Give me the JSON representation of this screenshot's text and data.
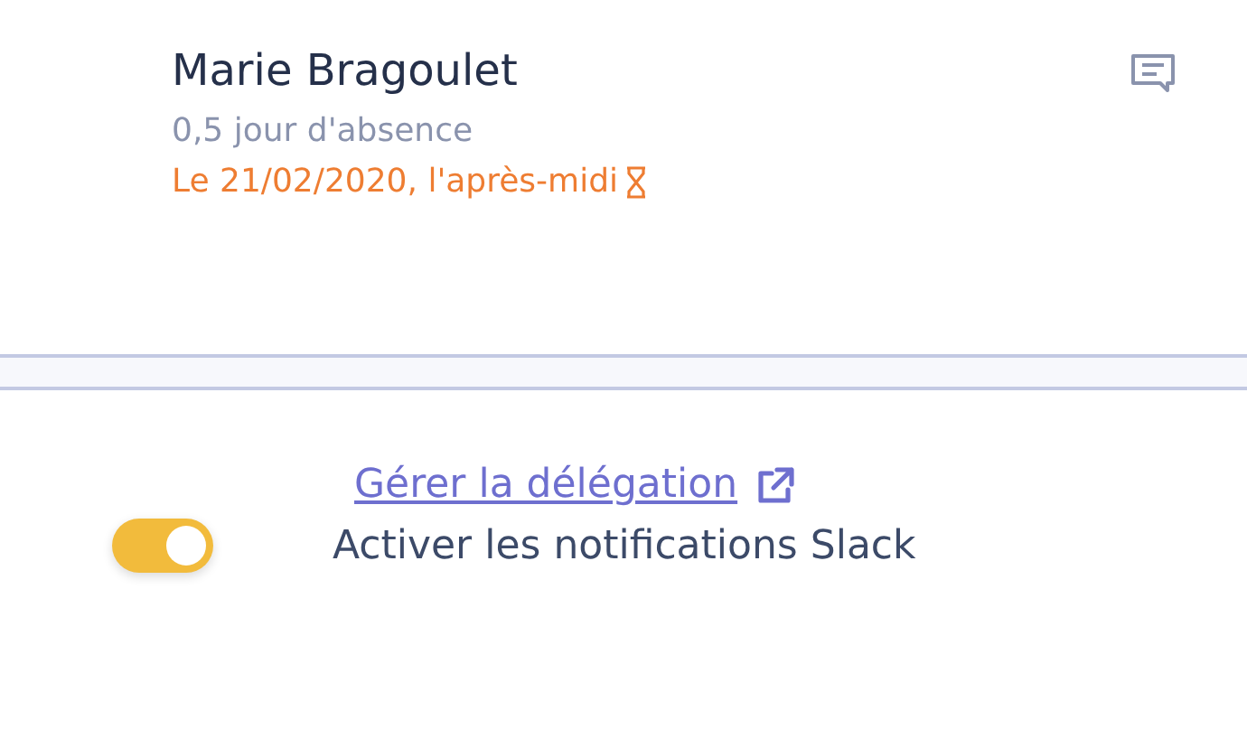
{
  "absence": {
    "name": "Marie Bragoulet",
    "duration": "0,5 jour d'absence",
    "date": "Le 21/02/2020, l'après-midi",
    "pending": true
  },
  "delegation_link": "Gérer la délégation",
  "slack_toggle": {
    "label": "Activer les notifications Slack",
    "on": true
  }
}
